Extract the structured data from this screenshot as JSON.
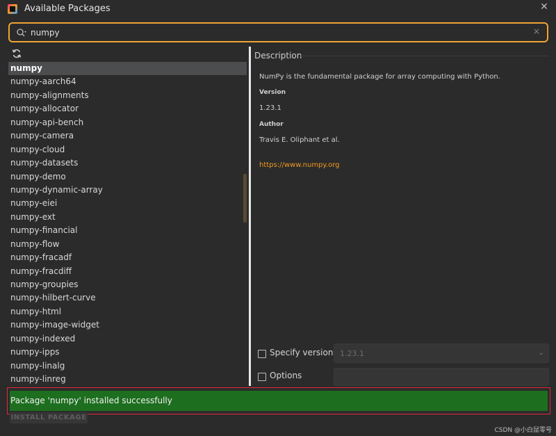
{
  "window": {
    "title": "Available Packages",
    "icon": "pycharm-app-icon",
    "close_icon": "close-icon"
  },
  "search": {
    "value": "numpy",
    "icon": "search-icon",
    "clear_label": "×"
  },
  "toolbar": {
    "refresh_icon": "refresh-icon"
  },
  "packages": [
    "numpy",
    "numpy-aarch64",
    "numpy-alignments",
    "numpy-allocator",
    "numpy-api-bench",
    "numpy-camera",
    "numpy-cloud",
    "numpy-datasets",
    "numpy-demo",
    "numpy-dynamic-array",
    "numpy-eiei",
    "numpy-ext",
    "numpy-financial",
    "numpy-flow",
    "numpy-fracadf",
    "numpy-fracdiff",
    "numpy-groupies",
    "numpy-hilbert-curve",
    "numpy-html",
    "numpy-image-widget",
    "numpy-indexed",
    "numpy-ipps",
    "numpy-linalg",
    "numpy-linreg"
  ],
  "selected_package": "numpy",
  "description": {
    "header": "Description",
    "summary": "NumPy is the fundamental package for array computing with Python.",
    "version_label": "Version",
    "version": "1.23.1",
    "author_label": "Author",
    "author": "Travis E. Oliphant et al.",
    "link": "https://www.numpy.org"
  },
  "options": {
    "specify_version_label": "Specify version",
    "specify_version_checked": false,
    "version_select_value": "1.23.1",
    "options_label": "Options",
    "options_checked": false,
    "options_value": ""
  },
  "status": {
    "message": "Package 'numpy' installed successfully"
  },
  "install_button": {
    "label": "INSTALL PACKAGE"
  },
  "watermark": "CSDN @小白鼠零号",
  "colors": {
    "accent_orange": "#f0a430",
    "link_orange": "#f09a1f",
    "success_green": "#1d6e1f",
    "highlight_red": "#e0293a",
    "background": "#2b2b2b"
  }
}
